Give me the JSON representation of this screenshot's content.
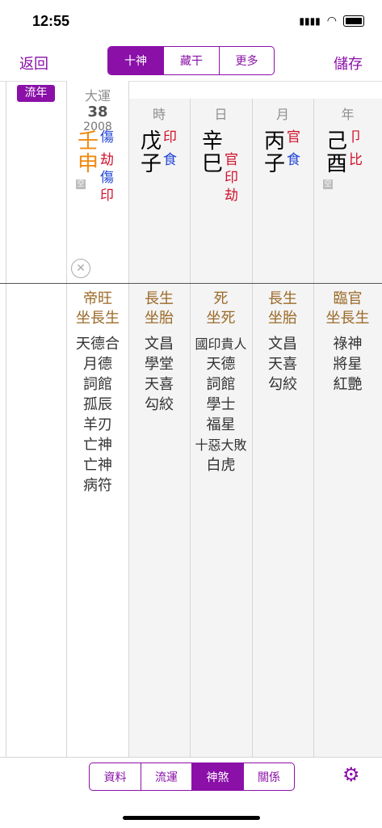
{
  "status": {
    "time": "12:55"
  },
  "nav": {
    "back": "返回",
    "save": "儲存",
    "segments": [
      "十神",
      "藏干",
      "更多"
    ]
  },
  "liunian": "流年",
  "dayun": {
    "header": "大運",
    "age": "38",
    "year": "2008",
    "stem": "壬",
    "branch": "申",
    "stem_god": "傷",
    "branch_gods": [
      "劫",
      "傷",
      "印"
    ],
    "kong": "空"
  },
  "pillars": [
    {
      "header": "時",
      "stem": "戊",
      "branch": "子",
      "stem_god": "印",
      "branch_gods": [
        "食"
      ]
    },
    {
      "header": "日",
      "stem": "辛",
      "branch": "巳",
      "stem_god": "",
      "branch_gods": [
        "官",
        "印",
        "劫"
      ]
    },
    {
      "header": "月",
      "stem": "丙",
      "branch": "子",
      "stem_god": "官",
      "branch_gods": [
        "食"
      ]
    },
    {
      "header": "年",
      "stem": "己",
      "branch": "酉",
      "stem_god": "卩",
      "branch_gods": [
        "比"
      ],
      "kong": "空"
    }
  ],
  "status_rows": [
    [
      "帝旺",
      "坐長生"
    ],
    [
      "長生",
      "坐胎"
    ],
    [
      "死",
      "坐死"
    ],
    [
      "長生",
      "坐胎"
    ],
    [
      "臨官",
      "坐長生"
    ]
  ],
  "shensha": [
    [
      "天德合",
      "月德",
      "詞館",
      "孤辰",
      "羊刃",
      "亡神",
      "亡神",
      "病符"
    ],
    [
      "文昌",
      "學堂",
      "天喜",
      "勾絞"
    ],
    [
      "國印貴人",
      "天德",
      "詞館",
      "學士",
      "福星",
      "十惡大敗",
      "白虎"
    ],
    [
      "文昌",
      "天喜",
      "勾絞"
    ],
    [
      "祿神",
      "將星",
      "紅艷"
    ]
  ],
  "bottom_tabs": [
    "資料",
    "流運",
    "神煞",
    "關係"
  ],
  "colors": {
    "accent": "#8a10a8",
    "red": "#d0102a",
    "blue": "#2548d6",
    "brown": "#9b6a28",
    "orange": "#f08a10"
  }
}
